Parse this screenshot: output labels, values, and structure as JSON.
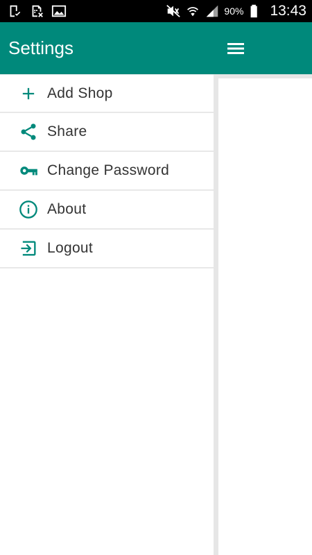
{
  "status_bar": {
    "left_icons": [
      "checkmark-doc-icon",
      "sim-x-icon",
      "image-icon"
    ],
    "right_icons": [
      "mute-icon",
      "wifi-icon",
      "signal-icon",
      "battery-icon"
    ],
    "battery": "90%",
    "time": "13:43"
  },
  "app_bar": {
    "title": "Settings",
    "menu_icon": "hamburger-icon",
    "color": "#00897b"
  },
  "drawer": {
    "items": [
      {
        "label": "Add Shop",
        "icon": "plus-icon"
      },
      {
        "label": "Share",
        "icon": "share-icon"
      },
      {
        "label": "Change Password",
        "icon": "key-icon"
      },
      {
        "label": "About",
        "icon": "info-icon"
      },
      {
        "label": "Logout",
        "icon": "logout-icon"
      }
    ],
    "icon_color": "#00897b"
  }
}
